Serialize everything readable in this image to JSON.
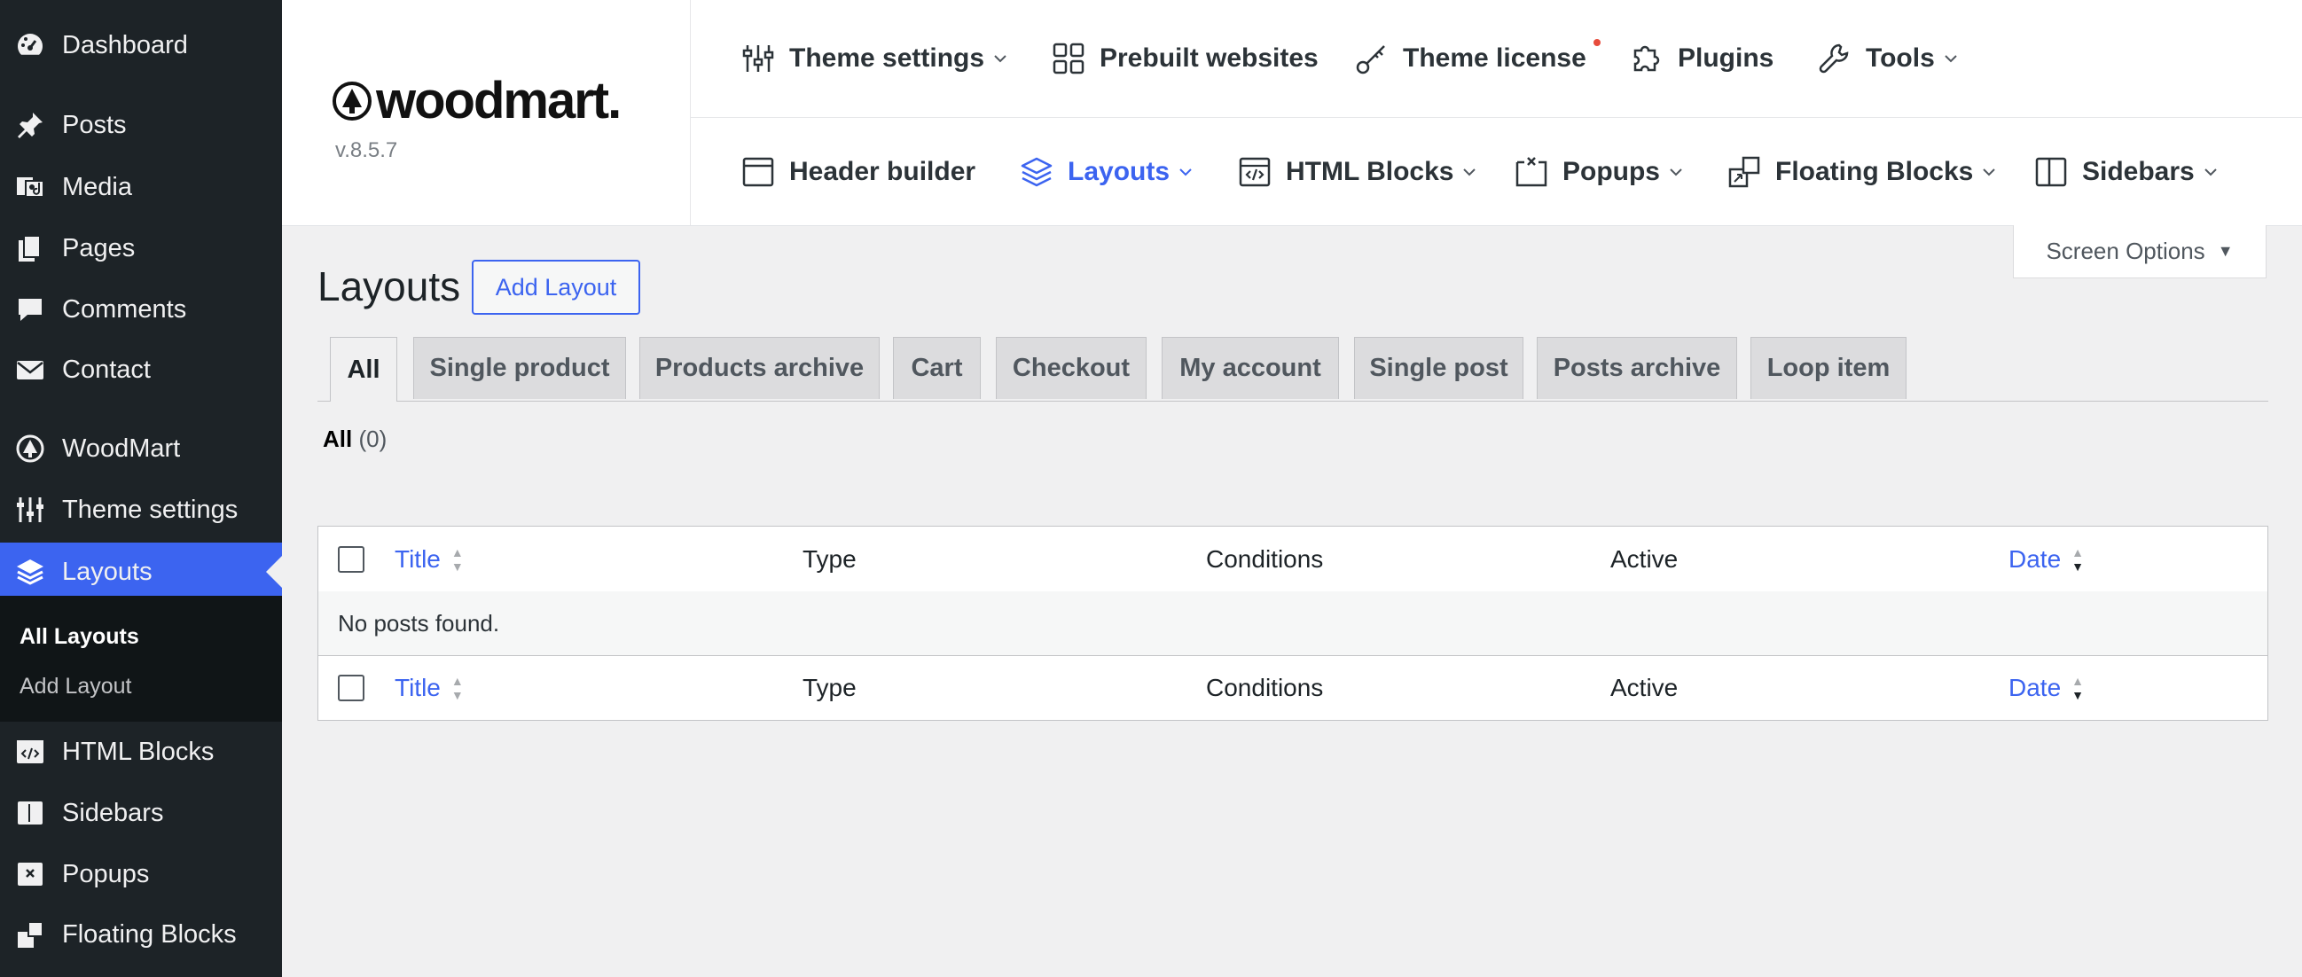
{
  "sidebar": {
    "items": [
      {
        "label": "Dashboard",
        "icon": "dashboard-icon"
      },
      {
        "label": "Posts",
        "icon": "pin-icon"
      },
      {
        "label": "Media",
        "icon": "media-icon"
      },
      {
        "label": "Pages",
        "icon": "pages-icon"
      },
      {
        "label": "Comments",
        "icon": "comment-icon"
      },
      {
        "label": "Contact",
        "icon": "mail-icon"
      },
      {
        "label": "WoodMart",
        "icon": "woodmart-icon"
      },
      {
        "label": "Theme settings",
        "icon": "sliders-icon"
      },
      {
        "label": "Layouts",
        "icon": "layers-icon"
      },
      {
        "label": "HTML Blocks",
        "icon": "html-block-icon"
      },
      {
        "label": "Sidebars",
        "icon": "sidebar-icon"
      },
      {
        "label": "Popups",
        "icon": "popup-icon"
      },
      {
        "label": "Floating Blocks",
        "icon": "floating-block-icon"
      }
    ],
    "submenu": {
      "all_layouts": "All Layouts",
      "add_layout": "Add Layout"
    }
  },
  "brand": {
    "logo": "woodmart.",
    "version": "v.8.5.7"
  },
  "nav_top": [
    {
      "label": "Theme settings",
      "icon": "sliders-icon"
    },
    {
      "label": "Prebuilt websites",
      "icon": "grid-icon"
    },
    {
      "label": "Theme license",
      "icon": "key-icon"
    },
    {
      "label": "Plugins",
      "icon": "puzzle-icon"
    },
    {
      "label": "Tools",
      "icon": "wrench-icon"
    }
  ],
  "nav_bottom": [
    {
      "label": "Header builder",
      "icon": "header-icon"
    },
    {
      "label": "Layouts",
      "icon": "layers-icon"
    },
    {
      "label": "HTML Blocks",
      "icon": "html-block-icon"
    },
    {
      "label": "Popups",
      "icon": "popup-icon"
    },
    {
      "label": "Floating Blocks",
      "icon": "floating-block-icon"
    },
    {
      "label": "Sidebars",
      "icon": "sidebar-icon"
    }
  ],
  "colors": {
    "accent": "#3c64f0",
    "sidebar_bg": "#1d2327",
    "notice_dot": "#e74c3c"
  },
  "screen_options": "Screen Options",
  "page": {
    "title": "Layouts",
    "add_button": "Add Layout"
  },
  "tabs": [
    "All",
    "Single product",
    "Products archive",
    "Cart",
    "Checkout",
    "My account",
    "Single post",
    "Posts archive",
    "Loop item"
  ],
  "filter": {
    "label": "All",
    "count": "(0)"
  },
  "table": {
    "columns": {
      "title": "Title",
      "type": "Type",
      "conditions": "Conditions",
      "active": "Active",
      "date": "Date"
    },
    "empty": "No posts found."
  }
}
